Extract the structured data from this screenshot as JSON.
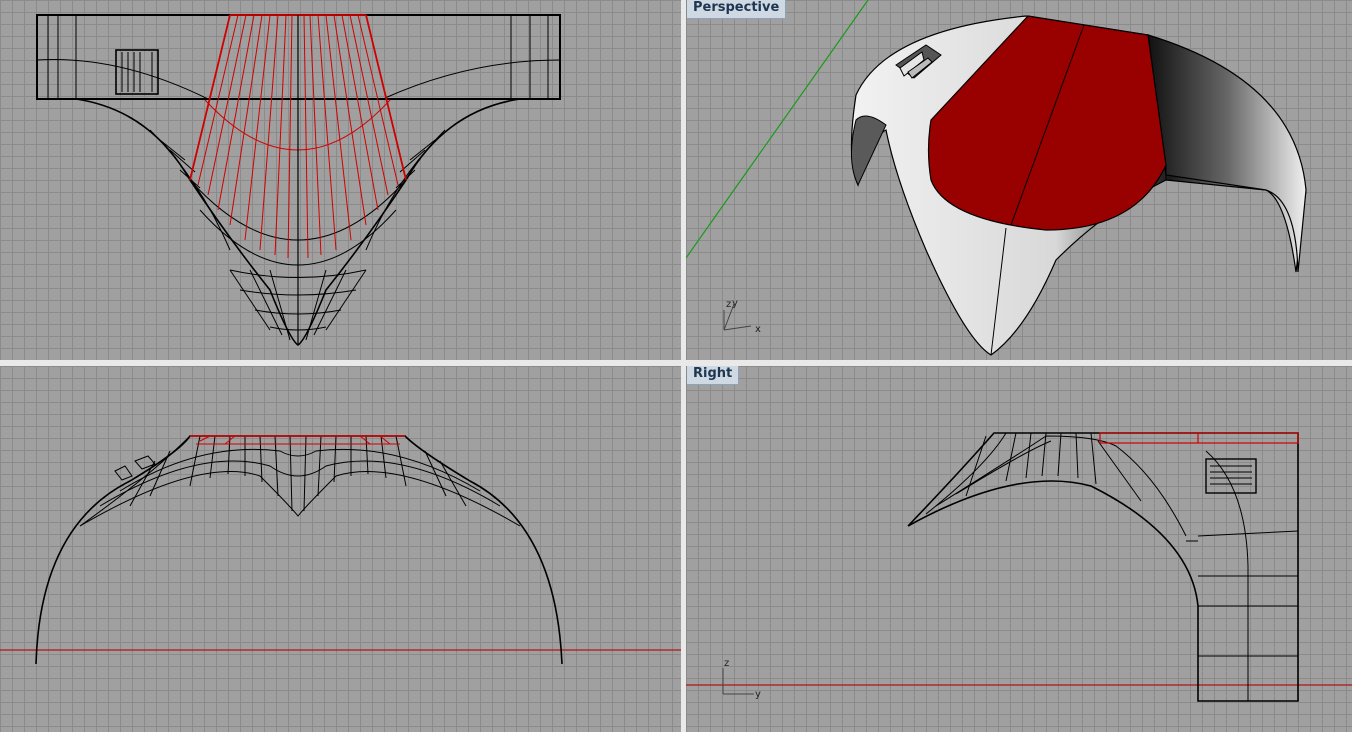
{
  "viewports": {
    "top": {
      "label": ""
    },
    "perspective": {
      "label": "Perspective"
    },
    "front": {
      "label": ""
    },
    "right": {
      "label": "Right"
    }
  },
  "axes": {
    "perspective": {
      "x": "x",
      "y": "y",
      "z": "z"
    },
    "right": {
      "y": "y",
      "z": "z"
    }
  },
  "colors": {
    "viewport_bg": "#a0a0a0",
    "grid": "#8b8b8b",
    "wire": "#000000",
    "selected": "#d00000",
    "red_surface": "#990000",
    "world_x_axis": "#b01515",
    "world_y_axis": "#1a9a1a"
  }
}
